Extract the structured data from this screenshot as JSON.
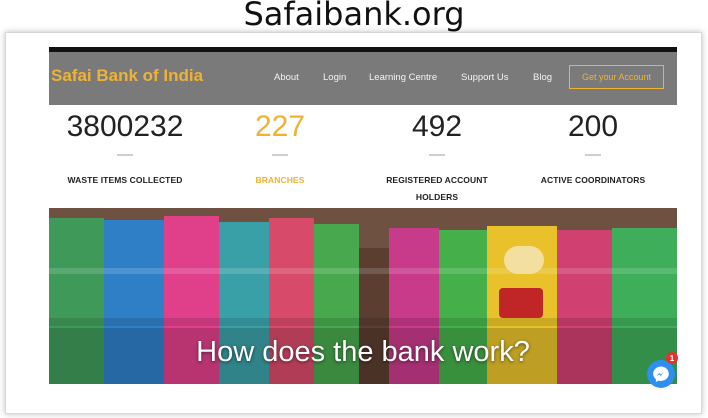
{
  "caption": "Safaibank.org",
  "site": {
    "brand": "Safai Bank of India",
    "nav": {
      "about": "About",
      "login": "Login",
      "learning": "Learning Centre",
      "support": "Support Us",
      "blog": "Blog",
      "cta": "Get your Account"
    }
  },
  "stats": [
    {
      "value": "3800232",
      "label": "WASTE ITEMS COLLECTED",
      "label2": ""
    },
    {
      "value": "227",
      "label": "BRANCHES",
      "label2": ""
    },
    {
      "value": "492",
      "label": "REGISTERED ACCOUNT",
      "label2": "HOLDERS"
    },
    {
      "value": "200",
      "label": "ACTIVE COORDINATORS",
      "label2": ""
    }
  ],
  "hero": {
    "title": "How does the bank work?"
  },
  "messenger": {
    "badge": "1",
    "icon": "messenger-icon"
  },
  "colors": {
    "accent": "#f0b233",
    "nav_bg": "#7a7a7a",
    "messenger": "#2f8ff0"
  }
}
